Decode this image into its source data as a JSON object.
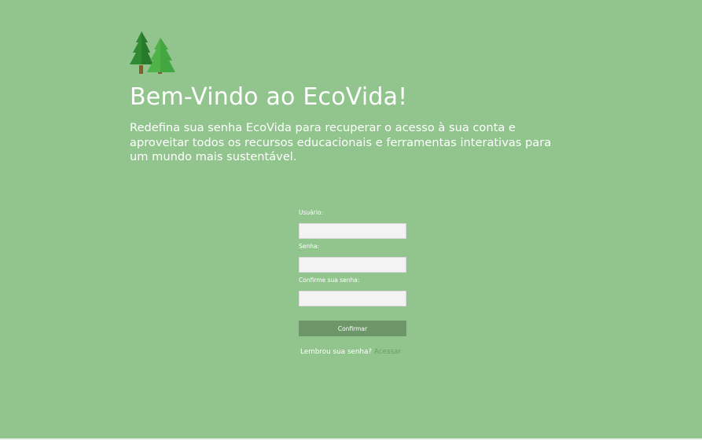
{
  "brand": {
    "logo_icon": "pine-trees-icon",
    "colors": {
      "background": "#92c58e",
      "tree_dark": "#2f8a32",
      "tree_light": "#4fb34a",
      "trunk": "#8a5a2b",
      "button": "#6d9768",
      "link": "#6e9b68"
    }
  },
  "hero": {
    "title": "Bem-Vindo ao EcoVida!",
    "description": "Redefina sua senha EcoVida para recuperar o acesso à sua conta e aproveitar todos os recursos educacionais e ferramentas interativas para um mundo mais sustentável."
  },
  "form": {
    "username_label": "Usuário:",
    "username_value": "",
    "password_label": "Senha:",
    "password_value": "",
    "confirm_label": "Confirme sua senha:",
    "confirm_value": "",
    "submit_label": "Confirmar"
  },
  "footer": {
    "remember_text": "Lembrou sua senha?",
    "access_link": "Acessar"
  }
}
